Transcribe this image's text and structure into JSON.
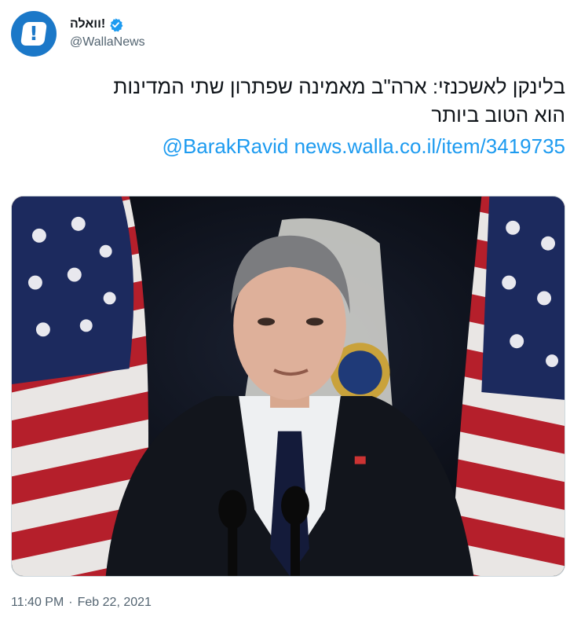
{
  "account": {
    "display_name": "וואלה!",
    "handle": "@WallaNews",
    "avatar_glyph": "!",
    "brand_color": "#1b78c8",
    "verified_icon": "verified-badge-icon"
  },
  "tweet": {
    "text_line1": "בלינקן לאשכנזי: ארה\"ב מאמינה שפתרון שתי המדינות",
    "text_line2": "הוא הטוב ביותר",
    "mention": "@BarakRavid",
    "url": "news.walla.co.il/item/3419735",
    "link_color": "#1d9bf0"
  },
  "media": {
    "kind": "photo"
  },
  "meta": {
    "time": "11:40 PM",
    "separator": "·",
    "date": "Feb 22, 2021"
  }
}
